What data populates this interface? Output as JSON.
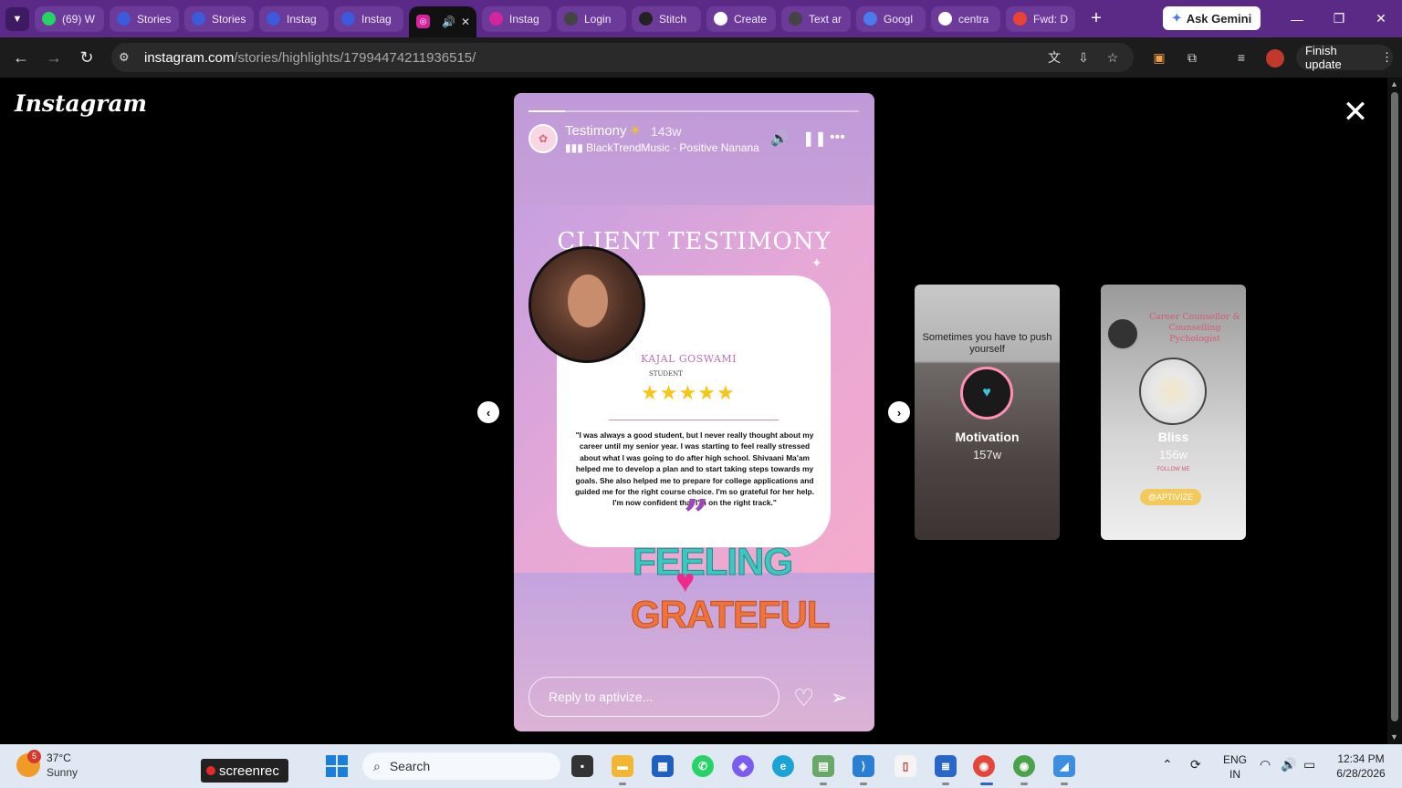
{
  "browser": {
    "tabs": [
      {
        "label": "(69) W",
        "icon": "whatsapp-icon",
        "color": "#25d366"
      },
      {
        "label": "Stories",
        "icon": "chrome-generic-icon",
        "color": "#3b5bdb"
      },
      {
        "label": "Stories",
        "icon": "chrome-generic-icon",
        "color": "#3b5bdb"
      },
      {
        "label": "Instag",
        "icon": "chrome-generic-icon",
        "color": "#3b5bdb"
      },
      {
        "label": "Instag",
        "icon": "chrome-generic-icon",
        "color": "#3b5bdb"
      }
    ],
    "active_tab": {
      "icon": "instagram-icon"
    },
    "tabs_after": [
      {
        "label": "Instag",
        "icon": "instagram-icon",
        "color": "#d6249f"
      },
      {
        "label": "Login",
        "icon": "chatgpt-icon",
        "color": "#444"
      },
      {
        "label": "Stitch",
        "icon": "stitch-icon",
        "color": "#222"
      },
      {
        "label": "Create",
        "icon": "google-icon",
        "color": "#fff"
      },
      {
        "label": "Text ar",
        "icon": "chatgpt-icon",
        "color": "#444"
      },
      {
        "label": "Googl",
        "icon": "google-translate-icon",
        "color": "#4a7cf0"
      },
      {
        "label": "centra",
        "icon": "google-icon",
        "color": "#fff"
      },
      {
        "label": "Fwd: D",
        "icon": "gmail-icon",
        "color": "#ea4335"
      }
    ],
    "gemini_label": "Ask Gemini",
    "url_host": "instagram.com",
    "url_path": "/stories/highlights/17994474211936515/",
    "finish_update": "Finish update"
  },
  "page": {
    "logo": "Instagram",
    "story": {
      "title": "Testimony",
      "time": "143w",
      "music": "BlackTrendMusic · Positive Nanana",
      "heading": "CLIENT TESTIMONY",
      "client_name": "KAJAL GOSWAMI",
      "client_role": "STUDENT",
      "rating_stars": 5,
      "quote": "\"I was always a good student, but I never really thought about my career until my senior year. I was starting to feel really stressed about what I was going to do after high school. Shivaani Ma'am helped me to develop a plan and to start taking steps towards my goals. She also helped me to prepare for college applications and guided me for the right course choice. I'm so grateful for her help. I'm now confident that I'm on the right track.\"",
      "sticker_line1": "FEELING",
      "sticker_line2": "GRATEFUL",
      "reply_placeholder": "Reply to aptivize...",
      "progress": 0.11
    },
    "side_stories": [
      {
        "top_text": "Sometimes you have to push yourself",
        "name": "Motivation",
        "time": "157w"
      },
      {
        "top_text": "Career Counsellor & Counselling Pychologist",
        "name": "Bliss",
        "time": "156w",
        "follow": "FOLLOW ME",
        "handle": "@APTIVIZE"
      }
    ]
  },
  "taskbar": {
    "weather_badge": "5",
    "temp": "37°C",
    "condition": "Sunny",
    "screenrec": "screenrec",
    "search": "Search",
    "lang_line1": "ENG",
    "lang_line2": "IN",
    "time": "12:34 PM",
    "date": "6/28/2026"
  }
}
